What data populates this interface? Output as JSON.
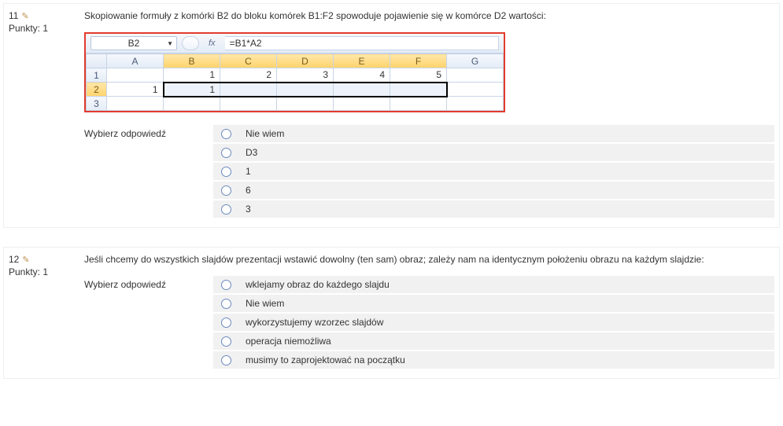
{
  "q11": {
    "number": "11",
    "points_label": "Punkty: 1",
    "text": "Skopiowanie formuły z komórki B2 do bloku komórek B1:F2 spowoduje pojawienie się w komórce D2 wartości:",
    "choose_label": "Wybierz odpowiedź",
    "answers": [
      "Nie wiem",
      "D3",
      "1",
      "6",
      "3"
    ]
  },
  "excel": {
    "namebox": "B2",
    "fx": "fx",
    "formula": "=B1*A2",
    "col_headers": [
      "A",
      "B",
      "C",
      "D",
      "E",
      "F",
      "G"
    ],
    "selected_cols": [
      "B",
      "C",
      "D",
      "E",
      "F"
    ],
    "rows": [
      {
        "hdr": "1",
        "cells": [
          "",
          "1",
          "2",
          "3",
          "4",
          "5",
          ""
        ]
      },
      {
        "hdr": "2",
        "cells": [
          "1",
          "1",
          "",
          "",
          "",
          "",
          ""
        ],
        "selected": true
      },
      {
        "hdr": "3",
        "cells": [
          "",
          "",
          "",
          "",
          "",
          "",
          ""
        ]
      }
    ]
  },
  "q12": {
    "number": "12",
    "points_label": "Punkty: 1",
    "text": "Jeśli chcemy do wszystkich slajdów prezentacji wstawić dowolny (ten sam) obraz; zależy nam na identycznym położeniu obrazu na każdym slajdzie:",
    "choose_label": "Wybierz odpowiedź",
    "answers": [
      "wklejamy obraz do każdego slajdu",
      "Nie wiem",
      "wykorzystujemy wzorzec slajdów",
      "operacja niemożliwa",
      "musimy to zaprojektować na początku"
    ]
  }
}
